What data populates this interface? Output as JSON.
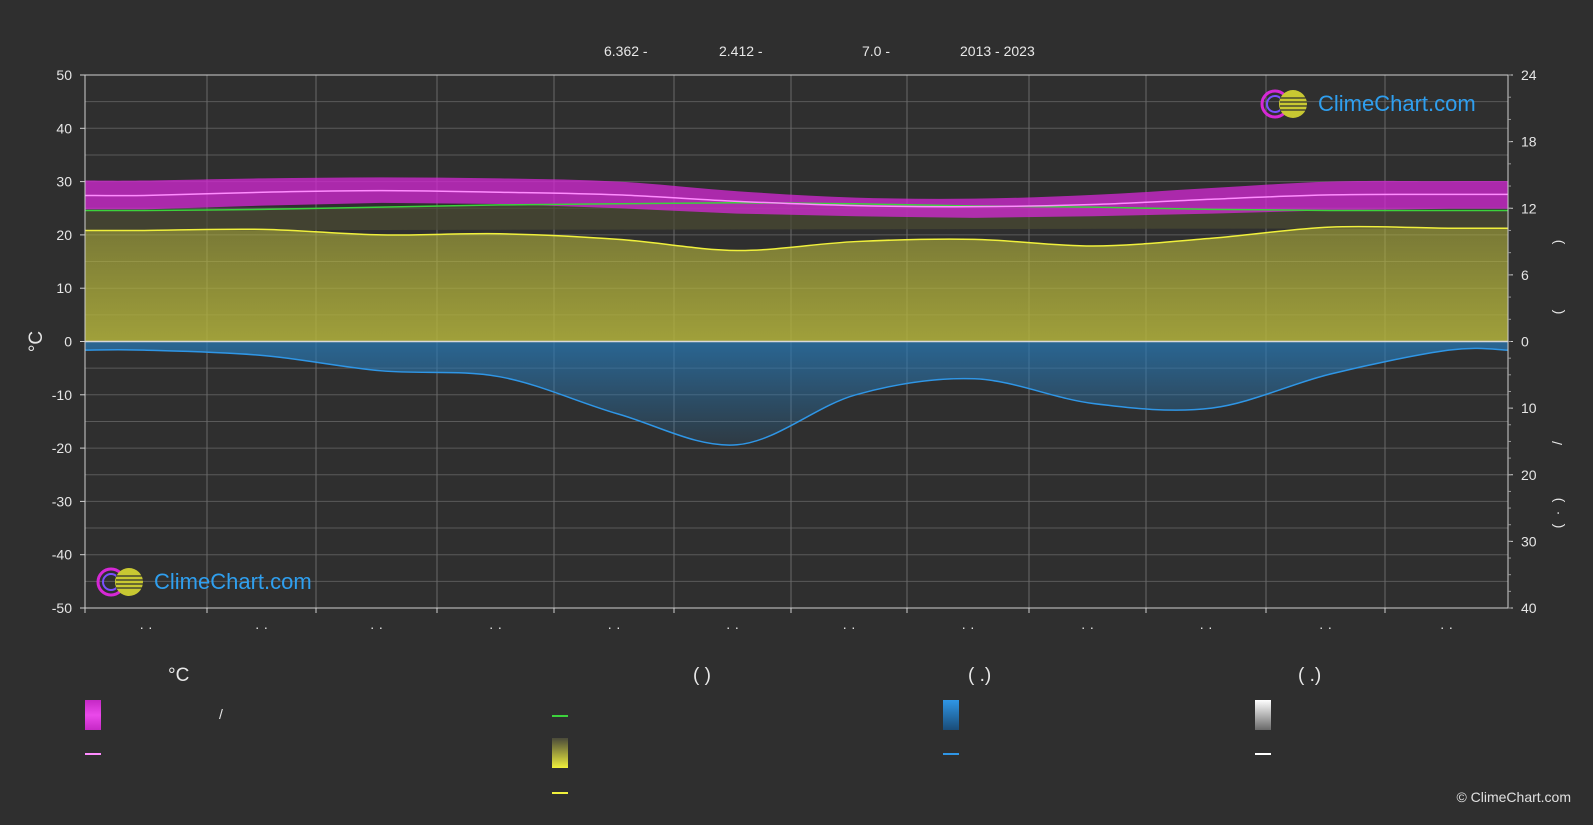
{
  "header": {
    "lat": "6.362 -",
    "lon": "2.412 -",
    "elev": "7.0 -",
    "years": "2013 - 2023"
  },
  "brand": {
    "logo_text": "ClimeChart.com",
    "copyright": "© ClimeChart.com"
  },
  "colors": {
    "background": "#2f2f2f",
    "temp_band": "#d628d6",
    "temp_mean_line": "#ff8cff",
    "daylight_line": "#3cd23c",
    "sunshine_fill": "#b4b43c",
    "sunshine_line": "#f0f03c",
    "precip_fill": "#2878b4",
    "precip_line": "#2f96e6",
    "snow_line": "#ffffff",
    "brand": "#2f9fef"
  },
  "legend": {
    "col1_title": "°C",
    "col1_band_label": "/",
    "col2_title": "(          )",
    "col3_title": "(    .)",
    "col4_title": "(    .)"
  },
  "chart_data": {
    "type": "line",
    "left_axis": {
      "label": "°C",
      "ylim": [
        -50,
        50
      ],
      "ticks": [
        "50",
        "40",
        "30",
        "20",
        "10",
        "0",
        "-10",
        "-20",
        "-30",
        "-40",
        "-50"
      ]
    },
    "right_axis_top": {
      "ylim": [
        0,
        24
      ],
      "ticks": [
        "24",
        "18",
        "12",
        "6",
        "0"
      ],
      "label_glyphs": [
        ")",
        "("
      ]
    },
    "right_axis_bottom": {
      "ylim": [
        0,
        40
      ],
      "ticks": [
        "10",
        "20",
        "30",
        "40"
      ],
      "label_glyphs": [
        "/",
        ")",
        "·",
        "("
      ]
    },
    "x_tick_labels": [
      "· ·",
      "· ·",
      "· ·",
      "· ·",
      "· ·",
      "· ·",
      "· ·",
      "· ·",
      "· ·",
      "· ·",
      "· ·",
      "· ·"
    ],
    "months": 12,
    "grid": true,
    "series": [
      {
        "key": "temp_max",
        "values": [
          30.2,
          30.6,
          30.8,
          30.6,
          30.0,
          28.2,
          27.0,
          26.8,
          27.5,
          28.8,
          30.0,
          30.1
        ]
      },
      {
        "key": "temp_min",
        "values": [
          24.8,
          25.5,
          26.0,
          25.8,
          25.0,
          24.0,
          23.5,
          23.2,
          23.5,
          24.0,
          24.6,
          24.9
        ]
      },
      {
        "key": "temp_mean",
        "values": [
          27.4,
          28.0,
          28.3,
          28.0,
          27.5,
          26.3,
          25.5,
          25.3,
          25.7,
          26.7,
          27.5,
          27.6
        ]
      },
      {
        "key": "daylight_hours",
        "values": [
          11.8,
          11.9,
          12.1,
          12.3,
          12.4,
          12.5,
          12.4,
          12.2,
          12.1,
          11.9,
          11.8,
          11.8
        ]
      },
      {
        "key": "sunshine_hours",
        "values": [
          10.0,
          10.1,
          9.6,
          9.7,
          9.2,
          8.2,
          9.0,
          9.2,
          8.6,
          9.3,
          10.3,
          10.2
        ]
      },
      {
        "key": "precip_mm",
        "values": [
          1.3,
          2.1,
          4.4,
          5.3,
          10.9,
          15.5,
          8.0,
          5.6,
          9.3,
          10.0,
          4.9,
          1.3
        ]
      }
    ]
  }
}
